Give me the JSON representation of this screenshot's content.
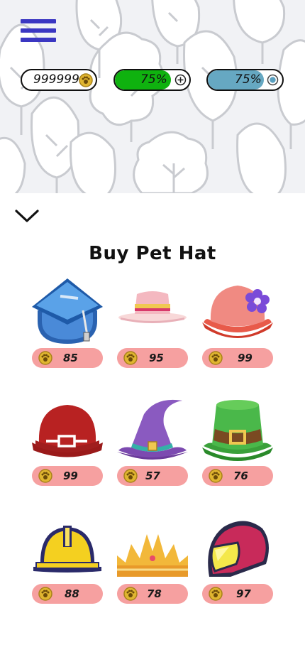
{
  "hud": {
    "coins": "999999",
    "health_label": "75%",
    "health_level": 0.75,
    "energy_label": "75%",
    "energy_level": 0.75,
    "colors": {
      "health": "#0fb20f",
      "energy": "#66a8c2",
      "menu": "#3b37c2"
    }
  },
  "shop": {
    "title": "Buy Pet Hat",
    "items": [
      {
        "hat": "graduation-cap",
        "price": "85"
      },
      {
        "hat": "sun-hat",
        "price": "95"
      },
      {
        "hat": "flower-bonnet",
        "price": "99"
      },
      {
        "hat": "bowler-hat",
        "price": "99"
      },
      {
        "hat": "witch-hat",
        "price": "57"
      },
      {
        "hat": "leprechaun-hat",
        "price": "76"
      },
      {
        "hat": "hard-hat",
        "price": "88"
      },
      {
        "hat": "crown",
        "price": "78"
      },
      {
        "hat": "motorcycle-helmet",
        "price": "97"
      }
    ],
    "price_pill_color": "#f6a0a0"
  }
}
